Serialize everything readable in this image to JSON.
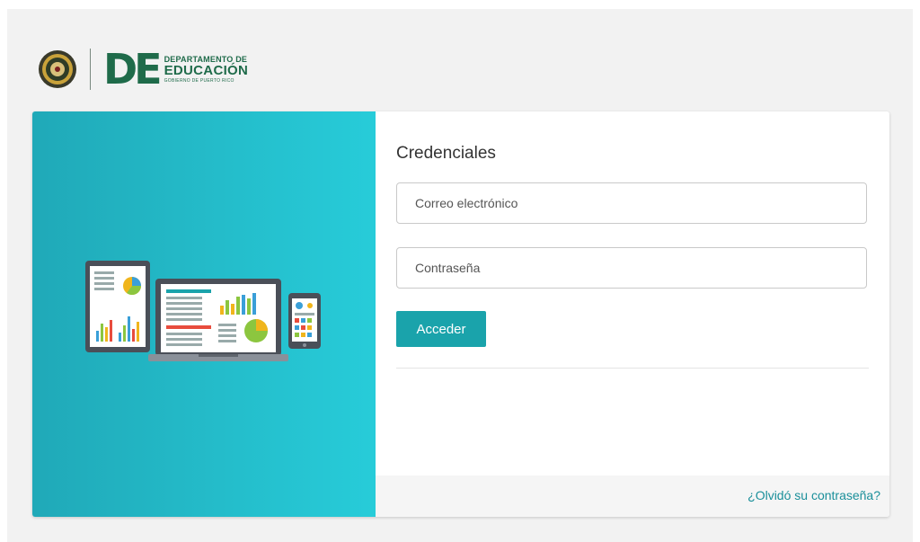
{
  "brand": {
    "logo_line1": "DEPARTAMENTO DE",
    "logo_line2": "EDUCACIÓN",
    "logo_line3": "GOBIERNO DE PUERTO RICO",
    "logo_letters": "DE",
    "brand_color": "#1f6b4a"
  },
  "login": {
    "title": "Credenciales",
    "email_placeholder": "Correo electrónico",
    "password_placeholder": "Contraseña",
    "submit_label": "Acceder",
    "forgot_label": "¿Olvidó su contraseña?"
  },
  "colors": {
    "accent": "#1aa3ab",
    "hero_start": "#20a9b8",
    "hero_end": "#27ccd9"
  }
}
